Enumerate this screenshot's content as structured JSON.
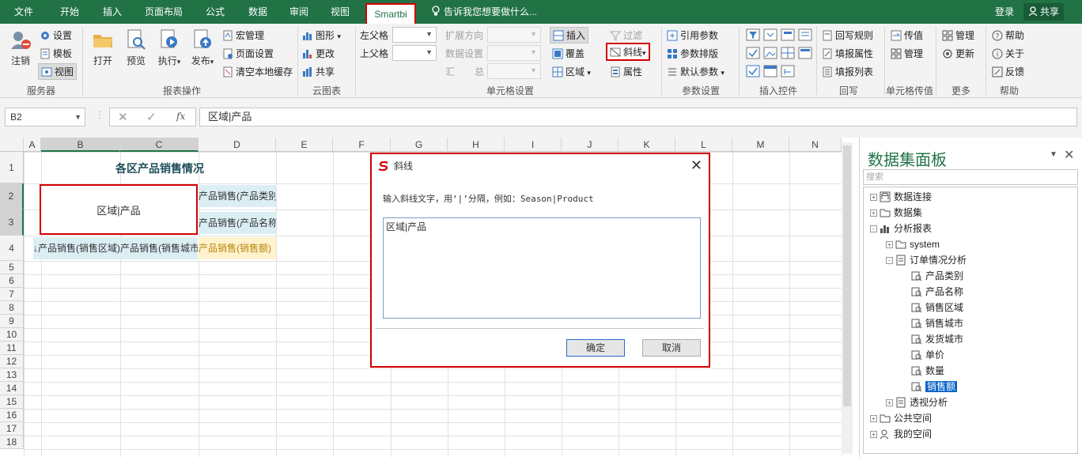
{
  "tabs": [
    "文件",
    "开始",
    "插入",
    "页面布局",
    "公式",
    "数据",
    "审阅",
    "视图",
    "Smartbi"
  ],
  "tellme": "告诉我您想要做什么...",
  "account": {
    "login": "登录",
    "share": "共享"
  },
  "ribbon": {
    "server": {
      "logout": "注销",
      "settings": "设置",
      "template": "模板",
      "view": "视图",
      "group": "服务器"
    },
    "report": {
      "open": "打开",
      "preview": "预览",
      "execute": "执行",
      "publish": "发布",
      "macro": "宏管理",
      "pagesetup": "页面设置",
      "clearcache": "清空本地缓存",
      "group": "报表操作"
    },
    "cloud": {
      "chart": "图形",
      "change": "更改",
      "share": "共享",
      "group": "云图表"
    },
    "cellset": {
      "leftparent": "左父格",
      "topparent": "上父格",
      "expanddir": "扩展方向",
      "dataset": "数据设置",
      "summary_a": "汇",
      "summary_b": "总",
      "insert": "插入",
      "cover": "覆盖",
      "area": "区域",
      "filter": "过滤",
      "diagonal": "斜线",
      "property": "属性",
      "group": "单元格设置"
    },
    "param": {
      "refparam": "引用参数",
      "paramlayout": "参数排版",
      "defaultparam": "默认参数",
      "group": "参数设置"
    },
    "controls": {
      "group": "插入控件"
    },
    "writeback": {
      "rule": "回写规则",
      "fillprop": "填报属性",
      "filllist": "填报列表",
      "group": "回写"
    },
    "cellpass": {
      "pass": "传值",
      "manage": "管理",
      "group": "单元格传值"
    },
    "more": {
      "manage": "管理",
      "update": "更新",
      "group": "更多"
    },
    "help": {
      "help": "帮助",
      "about": "关于",
      "feedback": "反馈",
      "group": "帮助"
    }
  },
  "formula": {
    "namebox": "B2",
    "content": "区域|产品"
  },
  "columns": [
    "A",
    "B",
    "C",
    "D",
    "E",
    "F",
    "G",
    "H",
    "I",
    "J",
    "K",
    "L",
    "M",
    "N"
  ],
  "rows": [
    "1",
    "2",
    "3",
    "4",
    "5",
    "6",
    "7",
    "8",
    "9",
    "10",
    "11",
    "12",
    "13",
    "14",
    "15",
    "16",
    "17",
    "18"
  ],
  "cells": {
    "title": "各区产品销售情况",
    "diag": "区域|产品",
    "d2": "产品销售(产品类别)",
    "d3": "产品销售(产品名称)",
    "b4": "↓产品销售(销售区域)",
    "c4": "产品销售(销售城市)",
    "d4": "产品销售(销售额)"
  },
  "panel": {
    "title": "数据集面板",
    "search_placeholder": "搜索",
    "tree": [
      {
        "label": "数据连接",
        "level": 0,
        "exp": "+",
        "icon": "db"
      },
      {
        "label": "数据集",
        "level": 0,
        "exp": "+",
        "icon": "folder"
      },
      {
        "label": "分析报表",
        "level": 0,
        "exp": "-",
        "icon": "chart"
      },
      {
        "label": "system",
        "level": 1,
        "exp": "+",
        "icon": "folder"
      },
      {
        "label": "订单情况分析",
        "level": 1,
        "exp": "-",
        "icon": "report"
      },
      {
        "label": "产品类别",
        "level": 2,
        "exp": "",
        "icon": "field"
      },
      {
        "label": "产品名称",
        "level": 2,
        "exp": "",
        "icon": "field"
      },
      {
        "label": "销售区域",
        "level": 2,
        "exp": "",
        "icon": "field"
      },
      {
        "label": "销售城市",
        "level": 2,
        "exp": "",
        "icon": "field"
      },
      {
        "label": "发货城市",
        "level": 2,
        "exp": "",
        "icon": "field"
      },
      {
        "label": "单价",
        "level": 2,
        "exp": "",
        "icon": "field"
      },
      {
        "label": "数量",
        "level": 2,
        "exp": "",
        "icon": "field"
      },
      {
        "label": "销售额",
        "level": 2,
        "exp": "",
        "icon": "field",
        "selected": true
      },
      {
        "label": "透视分析",
        "level": 1,
        "exp": "+",
        "icon": "report"
      },
      {
        "label": "公共空间",
        "level": 0,
        "exp": "+",
        "icon": "folder"
      },
      {
        "label": "我的空间",
        "level": 0,
        "exp": "+",
        "icon": "user"
      }
    ]
  },
  "dialog": {
    "title": "斜线",
    "label": "输入斜线文字，用‘|’分隔，例如：Season|Product",
    "value": "区域|产品",
    "ok": "确定",
    "cancel": "取消"
  },
  "colors": {
    "accent": "#217346",
    "highlight": "#d00000",
    "d_cell_bg": "#dbeef4",
    "yellow_cell": "#fff2cc"
  }
}
